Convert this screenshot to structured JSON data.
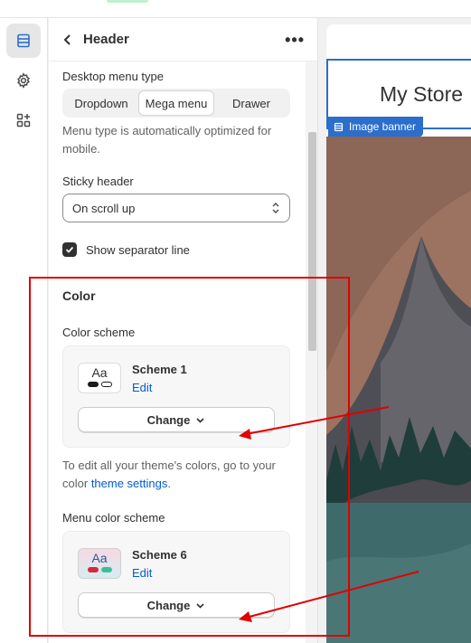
{
  "header": {
    "title": "Header"
  },
  "menu_type": {
    "label": "Desktop menu type",
    "options": [
      "Dropdown",
      "Mega menu",
      "Drawer"
    ],
    "selected": "Mega menu",
    "help": "Menu type is automatically optimized for mobile."
  },
  "sticky_header": {
    "label": "Sticky header",
    "value": "On scroll up"
  },
  "separator": {
    "label": "Show separator line",
    "checked": true
  },
  "color": {
    "section_title": "Color",
    "scheme": {
      "label": "Color scheme",
      "name": "Scheme 1",
      "edit": "Edit",
      "change": "Change"
    },
    "help_prefix": "To edit all your theme's colors, go to your color",
    "help_link": "theme settings",
    "help_suffix": ".",
    "menu_scheme": {
      "label": "Menu color scheme",
      "name": "Scheme 6",
      "edit": "Edit",
      "change": "Change"
    }
  },
  "preview": {
    "store_name": "My Store",
    "banner_tag": "Image banner"
  },
  "icons": [
    "sections-icon",
    "settings-gear-icon",
    "apps-icon",
    "chevron-left-icon",
    "more-horizontal-icon",
    "select-arrows-icon",
    "checkmark-icon",
    "chevron-down-icon"
  ],
  "colors": {
    "accent": "#005bd3",
    "selection": "#2c6ecb",
    "annotation": "#e00000"
  }
}
